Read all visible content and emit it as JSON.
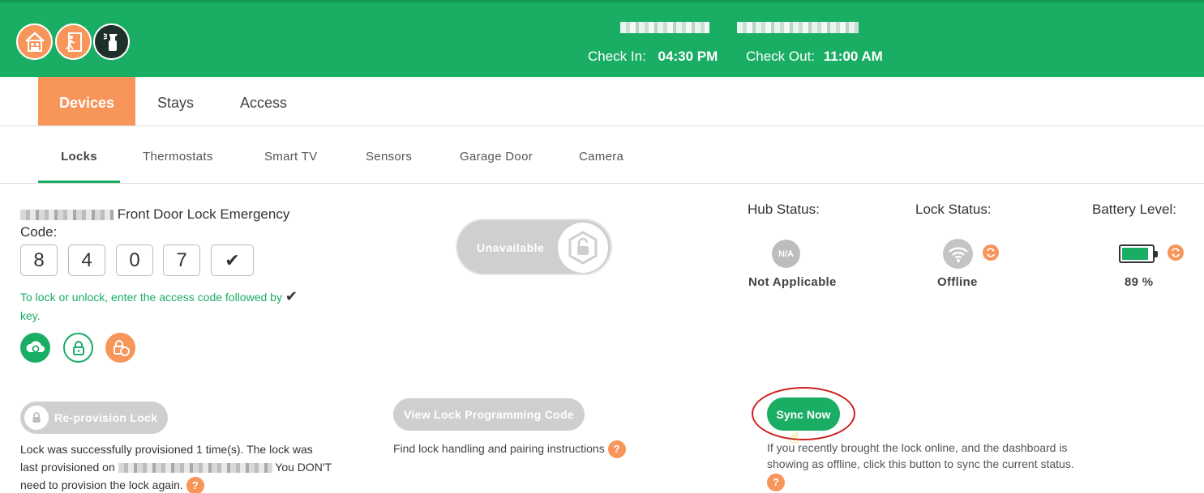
{
  "header": {
    "check_in_label": "Check In:",
    "check_in_time": "04:30 PM",
    "check_out_label": "Check Out:",
    "check_out_time": "11:00 AM",
    "icons": [
      "house-family-icon",
      "door-exit-icon",
      "spray-bottle-icon"
    ]
  },
  "main_tabs": [
    {
      "label": "Devices",
      "active": true
    },
    {
      "label": "Stays",
      "active": false
    },
    {
      "label": "Access",
      "active": false
    }
  ],
  "sub_tabs": [
    {
      "label": "Locks",
      "active": true
    },
    {
      "label": "Thermostats",
      "active": false
    },
    {
      "label": "Smart TV",
      "active": false
    },
    {
      "label": "Sensors",
      "active": false
    },
    {
      "label": "Garage Door",
      "active": false
    },
    {
      "label": "Camera",
      "active": false
    }
  ],
  "lock": {
    "title": "Front Door Lock Emergency",
    "code_label": "Code:",
    "code_digits": [
      "8",
      "4",
      "0",
      "7",
      "✔"
    ],
    "hint": "To lock or unlock, enter the access code followed by",
    "hint_check": "✔",
    "hint_tail": "key.",
    "toggle_label": "Unavailable"
  },
  "status": {
    "hub_label": "Hub Status:",
    "hub_badge": "N/A",
    "hub_value": "Not Applicable",
    "lock_label": "Lock Status:",
    "lock_value": "Offline",
    "battery_label": "Battery Level:",
    "battery_value": "89 %",
    "battery_level": 0.89
  },
  "actions": {
    "reprovision_label": "Re-provision Lock",
    "reprovision_desc_1": "Lock was successfully provisioned 1 time(s). The lock was",
    "reprovision_desc_2a": "last provisioned on",
    "reprovision_desc_2b": "You DON'T",
    "reprovision_desc_3": "need to provision the lock again.",
    "programming_label": "View Lock Programming Code",
    "programming_desc": "Find lock handling and pairing instructions",
    "sync_label": "Sync Now",
    "sync_desc_1": "If you recently brought the lock online, and the dashboard is",
    "sync_desc_2": "showing as offline, click this button to sync the current status.",
    "help_glyph": "?"
  },
  "colors": {
    "brand_green": "#1aad64",
    "accent_orange": "#f7955a",
    "disabled_grey": "#cfcfcf",
    "highlight_red": "#cc2222"
  }
}
